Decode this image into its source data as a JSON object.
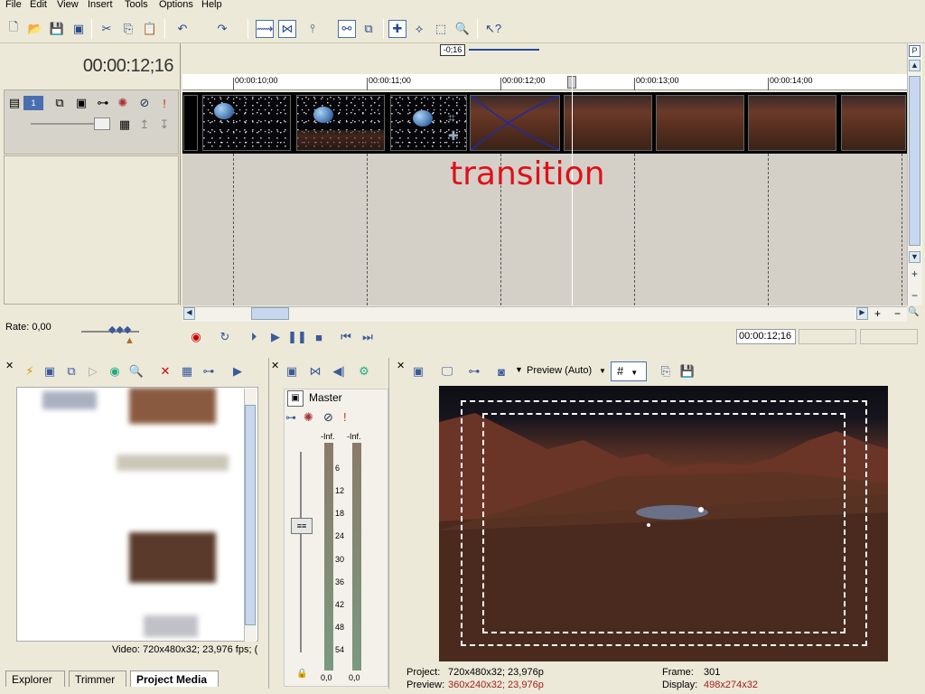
{
  "menu": [
    "File",
    "Edit",
    "View",
    "Insert",
    "Tools",
    "Options",
    "Help"
  ],
  "timeline": {
    "cursor_time": "00:00:12;16",
    "cursor_offset": "-0;16",
    "ruler_ticks": [
      "00:00:10;00",
      "00:00:11;00",
      "00:00:12;00",
      "00:00:13;00",
      "00:00:14;00"
    ],
    "annotation": "transition"
  },
  "rate": "Rate: 0,00",
  "transport": {
    "time": "00:00:12;16"
  },
  "explorer": {
    "media_info": "Video: 720x480x32; 23,976 fps; (",
    "tabs": [
      "Explorer",
      "Trimmer",
      "Project Media"
    ]
  },
  "mixer": {
    "master_label": "Master",
    "peak_left": "-Inf.",
    "peak_right": "-Inf.",
    "scale": [
      "6",
      "12",
      "18",
      "24",
      "30",
      "36",
      "42",
      "48",
      "54"
    ],
    "level_left": "0,0",
    "level_right": "0,0"
  },
  "preview": {
    "mode": "Preview (Auto)",
    "project_label": "Project:",
    "project_value": "720x480x32; 23,976p",
    "preview_label": "Preview:",
    "preview_value": "360x240x32; 23,976p",
    "frame_label": "Frame:",
    "frame_value": "301",
    "display_label": "Display:",
    "display_value": "498x274x32"
  },
  "colors": {
    "accent": "#4a6fb0",
    "annotation": "#e0101a",
    "background": "#ece9d8"
  }
}
